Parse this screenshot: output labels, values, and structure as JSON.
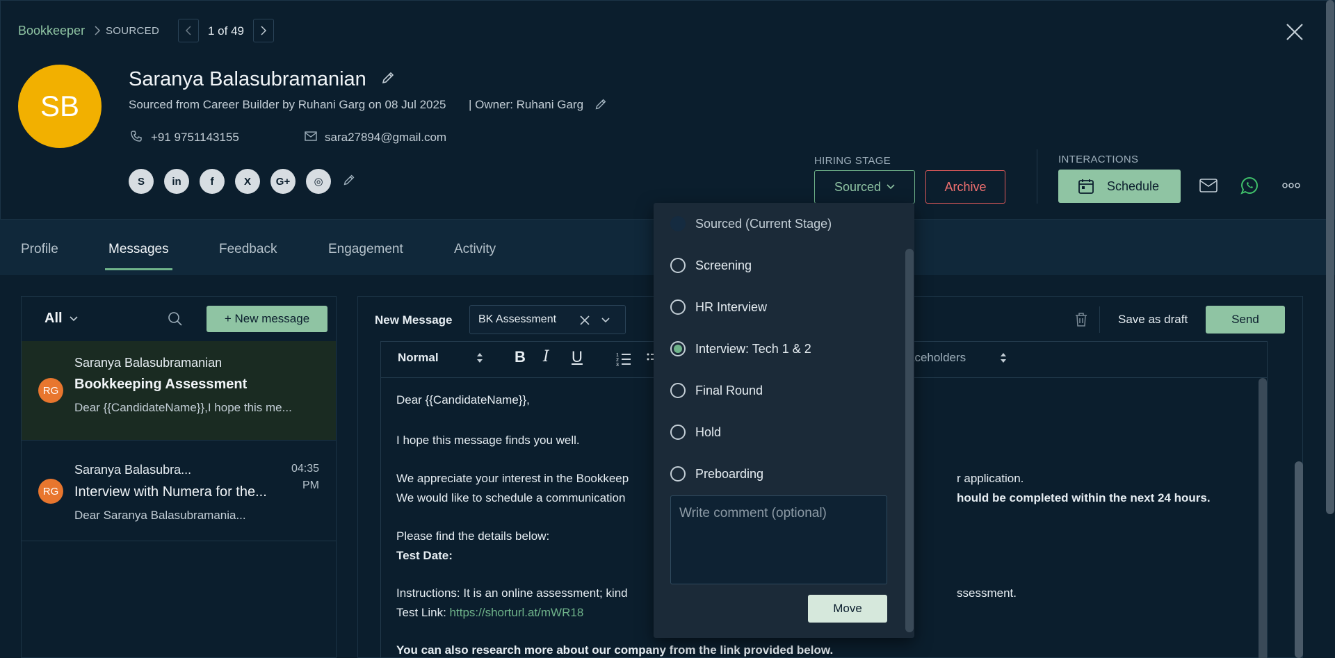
{
  "breadcrumb": {
    "parent": "Bookkeeper",
    "current": "SOURCED"
  },
  "pager": {
    "text": "1 of 49"
  },
  "candidate": {
    "initials": "SB",
    "name": "Saranya Balasubramanian",
    "source_line": "Sourced from Career Builder by Ruhani Garg on 08 Jul 2025",
    "owner_line": "| Owner: Ruhani Garg",
    "phone": "+91 9751143155",
    "email": "sara27894@gmail.com",
    "avatar_color": "#f2b000"
  },
  "social_icons": [
    "skype-icon",
    "linkedin-icon",
    "facebook-icon",
    "x-icon",
    "google-plus-icon",
    "website-icon"
  ],
  "social_glyphs": [
    "S",
    "in",
    "f",
    "X",
    "G+",
    "◎"
  ],
  "hiring_stage": {
    "label": "HIRING STAGE",
    "value": "Sourced",
    "archive": "Archive"
  },
  "interactions": {
    "label": "INTERACTIONS",
    "schedule": "Schedule"
  },
  "tabs": [
    "Profile",
    "Messages",
    "Feedback",
    "Engagement",
    "Activity"
  ],
  "active_tab": "Messages",
  "messages_panel": {
    "filter": "All",
    "new_message": "+ New message",
    "items": [
      {
        "initials": "RG",
        "sender": "Saranya Balasubramanian",
        "subject": "Bookkeeping Assessment",
        "preview": "Dear {{CandidateName}},I hope this me...",
        "time": ""
      },
      {
        "initials": "RG",
        "sender": "Saranya Balasubra...",
        "subject": "Interview with Numera for the...",
        "preview": "Dear Saranya Balasubramania...",
        "time": "04:35 PM"
      }
    ]
  },
  "composer": {
    "label": "New Message",
    "template": "BK Assessment",
    "save_draft": "Save as draft",
    "send": "Send",
    "toolbar": {
      "format": "Normal",
      "placeholders": "aceholders"
    },
    "body": {
      "greeting": "Dear {{CandidateName}},",
      "line1": "I hope this message finds you well.",
      "line2a": "We appreciate your interest in the Bookkeep",
      "line2b": "r application.",
      "line3a": "We would like to schedule a communication",
      "line3b": "hould be completed within the next 24 hours.",
      "line4": "Please find the details below:",
      "line5": "Test Date:",
      "line6a": "Instructions: It is an online assessment; kind",
      "line6b": "ssessment.",
      "line7_label": "Test Link: ",
      "line7_link": "https://shorturl.at/mWR18",
      "line8": "You can also research more about our company from the link provided below."
    }
  },
  "stage_dropdown": {
    "options": [
      {
        "label": "Sourced (Current Stage)",
        "state": "current"
      },
      {
        "label": "Screening",
        "state": "unchecked"
      },
      {
        "label": "HR Interview",
        "state": "unchecked"
      },
      {
        "label": "Interview: Tech 1 & 2",
        "state": "checked"
      },
      {
        "label": "Final Round",
        "state": "unchecked"
      },
      {
        "label": "Hold",
        "state": "unchecked"
      },
      {
        "label": "Preboarding",
        "state": "unchecked"
      }
    ],
    "comment_placeholder": "Write comment (optional)",
    "move": "Move"
  },
  "colors": {
    "accent": "#8fc4a3",
    "danger": "#e05a5a",
    "background": "#0b1e2d",
    "badge": "#e8762e"
  }
}
